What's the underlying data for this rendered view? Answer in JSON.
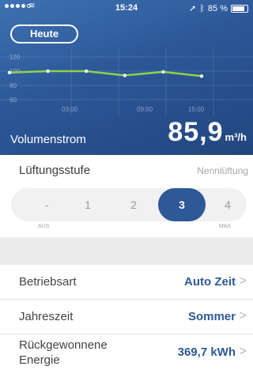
{
  "statusbar": {
    "time": "15:24",
    "battery": "85 %",
    "battery_level": 0.85,
    "wifi_icon": "wifi-icon",
    "location_icon": "location-arrow-icon",
    "bluetooth_icon": "bluetooth-icon"
  },
  "header": {
    "heute_label": "Heute",
    "volume_label": "Volumenstrom",
    "volume_value": "85,9",
    "volume_unit": "m³/h"
  },
  "chart_data": {
    "type": "line",
    "y_ticks": [
      "120",
      "100",
      "80",
      "60"
    ],
    "x_ticks": [
      "03:00",
      "09:00",
      "15:00"
    ],
    "ylim": [
      60,
      120
    ],
    "x": [
      0,
      3,
      6,
      9,
      12,
      15
    ],
    "values": [
      98,
      100,
      100,
      94,
      99,
      93
    ],
    "color": "#8ed24a"
  },
  "ventilation": {
    "title": "Lüftungsstufe",
    "mode": "Nennlüftung",
    "options": [
      "-",
      "1",
      "2",
      "3",
      "4"
    ],
    "active_index": 3,
    "min_label": "AUS",
    "max_label": "MAX"
  },
  "settings": {
    "rows": [
      {
        "label": "Betriebsart",
        "value": "Auto Zeit"
      },
      {
        "label": "Jahreszeit",
        "value": "Sommer"
      },
      {
        "label_line1": "Rückgewonnene",
        "label_line2": "Energie",
        "value": "369,7 kWh"
      }
    ],
    "chevron": ">"
  },
  "colors": {
    "accent": "#2d5996",
    "line": "#8ed24a",
    "header_bg": "#2c5797"
  }
}
